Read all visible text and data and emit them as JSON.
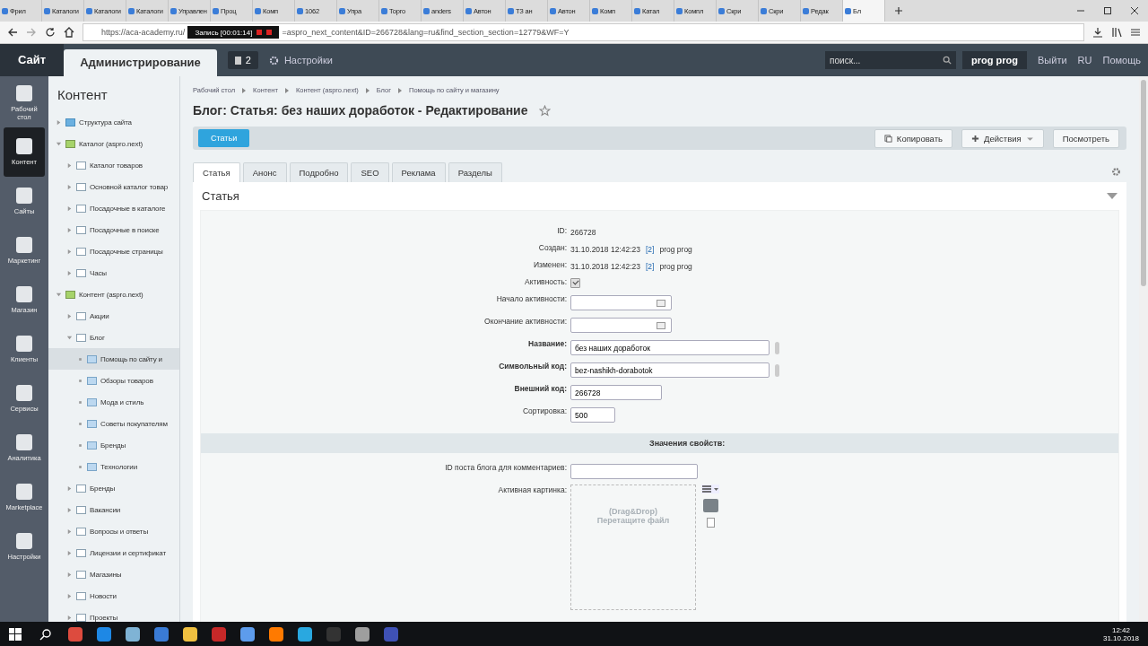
{
  "browser": {
    "tabs": [
      {
        "label": "Фрил",
        "selected": false
      },
      {
        "label": "Каталоги",
        "selected": false
      },
      {
        "label": "Каталоги",
        "selected": false
      },
      {
        "label": "Каталоги",
        "selected": false
      },
      {
        "label": "Управлен",
        "selected": false
      },
      {
        "label": "Проц",
        "selected": false
      },
      {
        "label": "Комп",
        "selected": false
      },
      {
        "label": "1062",
        "selected": false
      },
      {
        "label": "Упра",
        "selected": false
      },
      {
        "label": "Торго",
        "selected": false
      },
      {
        "label": "anders",
        "selected": false
      },
      {
        "label": "Автон",
        "selected": false
      },
      {
        "label": "ТЗ ан",
        "selected": false
      },
      {
        "label": "Автон",
        "selected": false
      },
      {
        "label": "Комп",
        "selected": false
      },
      {
        "label": "Катал",
        "selected": false
      },
      {
        "label": "Компл",
        "selected": false
      },
      {
        "label": "Скри",
        "selected": false
      },
      {
        "label": "Скри",
        "selected": false
      },
      {
        "label": "Редак",
        "selected": false
      },
      {
        "label": "Бл",
        "selected": true
      }
    ],
    "url_start": "https://aca-academy.ru/",
    "url_end": "=aspro_next_content&ID=266728&lang=ru&find_section_section=12779&WF=Y"
  },
  "recorder": {
    "title": "Запись [00:01:14]"
  },
  "admin_header": {
    "site_tab": "Сайт",
    "admin_tab": "Администрирование",
    "notifications": "2",
    "settings": "Настройки",
    "search_placeholder": "поиск...",
    "user": "prog prog",
    "logout": "Выйти",
    "language": "RU",
    "help": "Помощь"
  },
  "nav": [
    {
      "label": "Рабочий стол",
      "selected": false
    },
    {
      "label": "Контент",
      "selected": true
    },
    {
      "label": "Сайты",
      "selected": false
    },
    {
      "label": "Маркетинг",
      "selected": false
    },
    {
      "label": "Магазин",
      "selected": false
    },
    {
      "label": "Клиенты",
      "selected": false
    },
    {
      "label": "Сервисы",
      "selected": false
    },
    {
      "label": "Аналитика",
      "selected": false
    },
    {
      "label": "Marketplace",
      "selected": false
    },
    {
      "label": "Настройки",
      "selected": false
    }
  ],
  "tree": {
    "title": "Контент",
    "items": [
      {
        "label": "Структура сайта",
        "kind": "structure",
        "expanded": false,
        "selected": false
      },
      {
        "label": "Каталог (aspro.next)",
        "kind": "type",
        "expanded": true,
        "selected": false,
        "children": [
          {
            "label": "Каталог товаров",
            "kind": "iblock",
            "expanded": false,
            "selected": false
          },
          {
            "label": "Основной каталог товар",
            "kind": "iblock",
            "expanded": false,
            "selected": false
          },
          {
            "label": "Посадочные в каталоге",
            "kind": "iblock",
            "expanded": false,
            "selected": false
          },
          {
            "label": "Посадочные в поиске",
            "kind": "iblock",
            "expanded": false,
            "selected": false
          },
          {
            "label": "Посадочные страницы",
            "kind": "iblock",
            "expanded": false,
            "selected": false
          },
          {
            "label": "Часы",
            "kind": "iblock",
            "expanded": false,
            "selected": false
          }
        ]
      },
      {
        "label": "Контент (aspro.next)",
        "kind": "type",
        "expanded": true,
        "selected": false,
        "children": [
          {
            "label": "Акции",
            "kind": "iblock",
            "expanded": false,
            "selected": false
          },
          {
            "label": "Блог",
            "kind": "iblock",
            "expanded": true,
            "selected": false,
            "children": [
              {
                "label": "Помощь по сайту и",
                "kind": "section",
                "selected": true
              },
              {
                "label": "Обзоры товаров",
                "kind": "section",
                "selected": false
              },
              {
                "label": "Мода и стиль",
                "kind": "section",
                "selected": false
              },
              {
                "label": "Советы покупателям",
                "kind": "section",
                "selected": false
              },
              {
                "label": "Бренды",
                "kind": "section",
                "selected": false
              },
              {
                "label": "Технологии",
                "kind": "section",
                "selected": false
              }
            ]
          },
          {
            "label": "Бренды",
            "kind": "iblock",
            "expanded": false,
            "selected": false
          },
          {
            "label": "Вакансии",
            "kind": "iblock",
            "expanded": false,
            "selected": false
          },
          {
            "label": "Вопросы и ответы",
            "kind": "iblock",
            "expanded": false,
            "selected": false
          },
          {
            "label": "Лицензии и сертификат",
            "kind": "iblock",
            "expanded": false,
            "selected": false
          },
          {
            "label": "Магазины",
            "kind": "iblock",
            "expanded": false,
            "selected": false
          },
          {
            "label": "Новости",
            "kind": "iblock",
            "expanded": false,
            "selected": false
          },
          {
            "label": "Проекты",
            "kind": "iblock",
            "expanded": false,
            "selected": false
          }
        ]
      }
    ]
  },
  "breadcrumbs": [
    "Рабочий стол",
    "Контент",
    "Контент (aspro.next)",
    "Блог",
    "Помощь по сайту и магазину"
  ],
  "page_title": "Блог: Статья: без наших доработок - Редактирование",
  "toolbar": {
    "back_button": "Статьи",
    "buttons": [
      {
        "label": "Копировать",
        "kind": "copy"
      },
      {
        "label": "Действия",
        "kind": "actions"
      },
      {
        "label": "Посмотреть",
        "kind": "plain"
      }
    ]
  },
  "tabs": [
    {
      "label": "Статья",
      "selected": true
    },
    {
      "label": "Анонс",
      "selected": false
    },
    {
      "label": "Подробно",
      "selected": false
    },
    {
      "label": "SEO",
      "selected": false
    },
    {
      "label": "Реклама",
      "selected": false
    },
    {
      "label": "Разделы",
      "selected": false
    }
  ],
  "section_title": "Статья",
  "fields": [
    {
      "label": "ID:",
      "kind": "text",
      "value": "266728",
      "required": false
    },
    {
      "label": "Создан:",
      "kind": "user",
      "value": "31.10.2018 12:42:23",
      "user_id": "[2]",
      "user": "prog prog",
      "required": false
    },
    {
      "label": "Изменен:",
      "kind": "user",
      "value": "31.10.2018 12:42:23",
      "user_id": "[2]",
      "user": "prog prog",
      "required": false
    },
    {
      "label": "Активность:",
      "kind": "checkbox",
      "checked": true,
      "required": false
    },
    {
      "label": "Начало активности:",
      "kind": "date",
      "required": false
    },
    {
      "label": "Окончание активности:",
      "kind": "date",
      "required": false
    },
    {
      "label": "Название:",
      "kind": "long",
      "value": "без наших доработок",
      "required": true
    },
    {
      "label": "Символьный код:",
      "kind": "long",
      "value": "bez-nashikh-dorabotok",
      "required": true
    },
    {
      "label": "Внешний код:",
      "kind": "medium",
      "value": "266728",
      "required": true
    },
    {
      "label": "Сортировка:",
      "kind": "short",
      "value": "500",
      "required": false
    }
  ],
  "properties": {
    "title": "Значения свойств:",
    "fields": [
      {
        "label": "ID поста блога для комментариев:",
        "kind": "input"
      },
      {
        "label": "Активная картинка:",
        "kind": "file",
        "drop_text": "(Drag&Drop)",
        "drop_hint": "Перетащите файл"
      }
    ]
  },
  "taskbar": {
    "time": "12:42",
    "date": "31.10.2018"
  }
}
